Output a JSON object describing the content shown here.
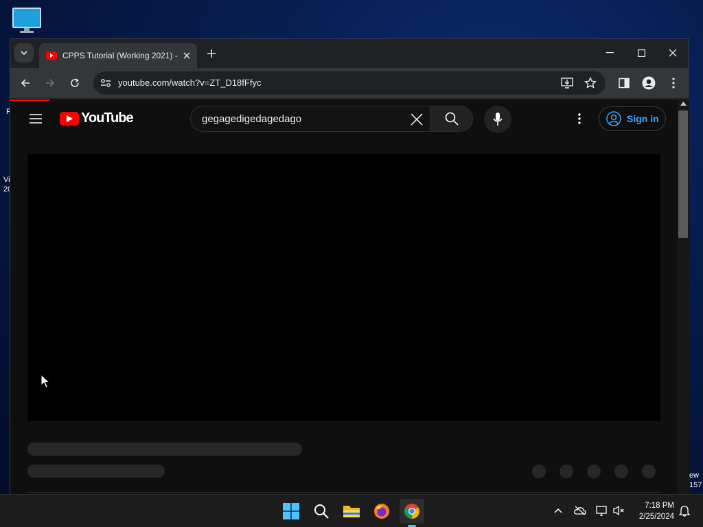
{
  "desktop": {
    "icon": "computer-monitor-icon",
    "edge_texts": [
      "R",
      "Vi",
      "20",
      "ew",
      "157"
    ]
  },
  "browser": {
    "tab": {
      "title": "CPPS Tutorial (Working 2021) -",
      "favicon": "youtube-favicon-icon"
    },
    "address": "youtube.com/watch?v=ZT_D18fFfyc",
    "accent_color": "#ff0000"
  },
  "youtube": {
    "logo_text": "YouTube",
    "search_value": "gegagedigedagedago",
    "sign_in_label": "Sign in",
    "link_color": "#3ea6ff"
  },
  "taskbar": {
    "apps": [
      "windows-start-icon",
      "search-icon",
      "file-explorer-icon",
      "firefox-icon",
      "chrome-icon"
    ],
    "time": "7:18 PM",
    "date": "2/25/2024"
  }
}
